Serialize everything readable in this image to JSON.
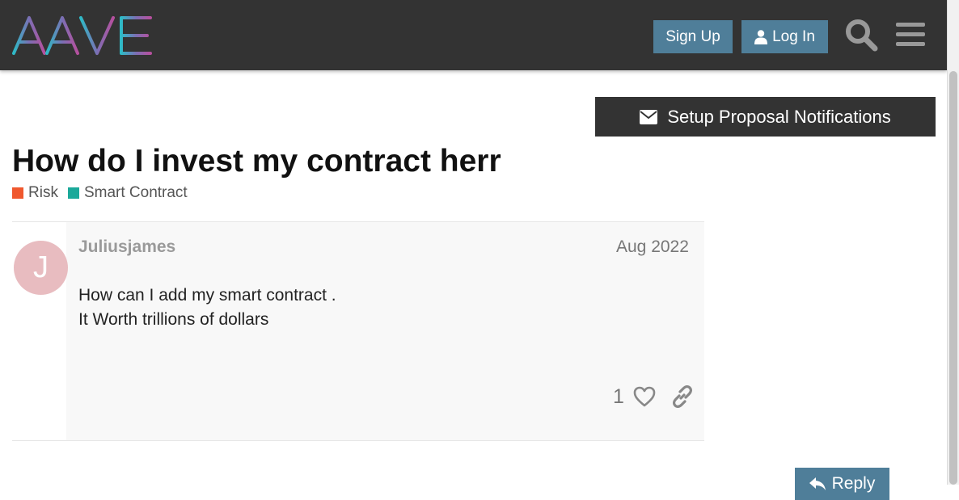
{
  "header": {
    "logo_text": "AAVE",
    "signup_label": "Sign Up",
    "login_label": "Log In",
    "search_icon": "search-icon",
    "menu_icon": "hamburger-icon"
  },
  "notifications": {
    "label": "Setup Proposal Notifications",
    "icon": "envelope-icon"
  },
  "topic": {
    "title": "How do I invest my contract herr",
    "tags": [
      {
        "label": "Risk",
        "color": "#f0582e"
      },
      {
        "label": "Smart Contract",
        "color": "#1ba99a"
      }
    ]
  },
  "post": {
    "avatar_letter": "J",
    "avatar_color": "#e8bcc0",
    "username": "Juliusjames",
    "date": "Aug 2022",
    "lines": [
      "How can I add my smart contract .",
      "It Worth trillions of dollars"
    ],
    "like_count": "1"
  },
  "reply": {
    "label": "Reply"
  },
  "colors": {
    "header_bg": "#333333",
    "button_bg": "#4f7e99"
  }
}
